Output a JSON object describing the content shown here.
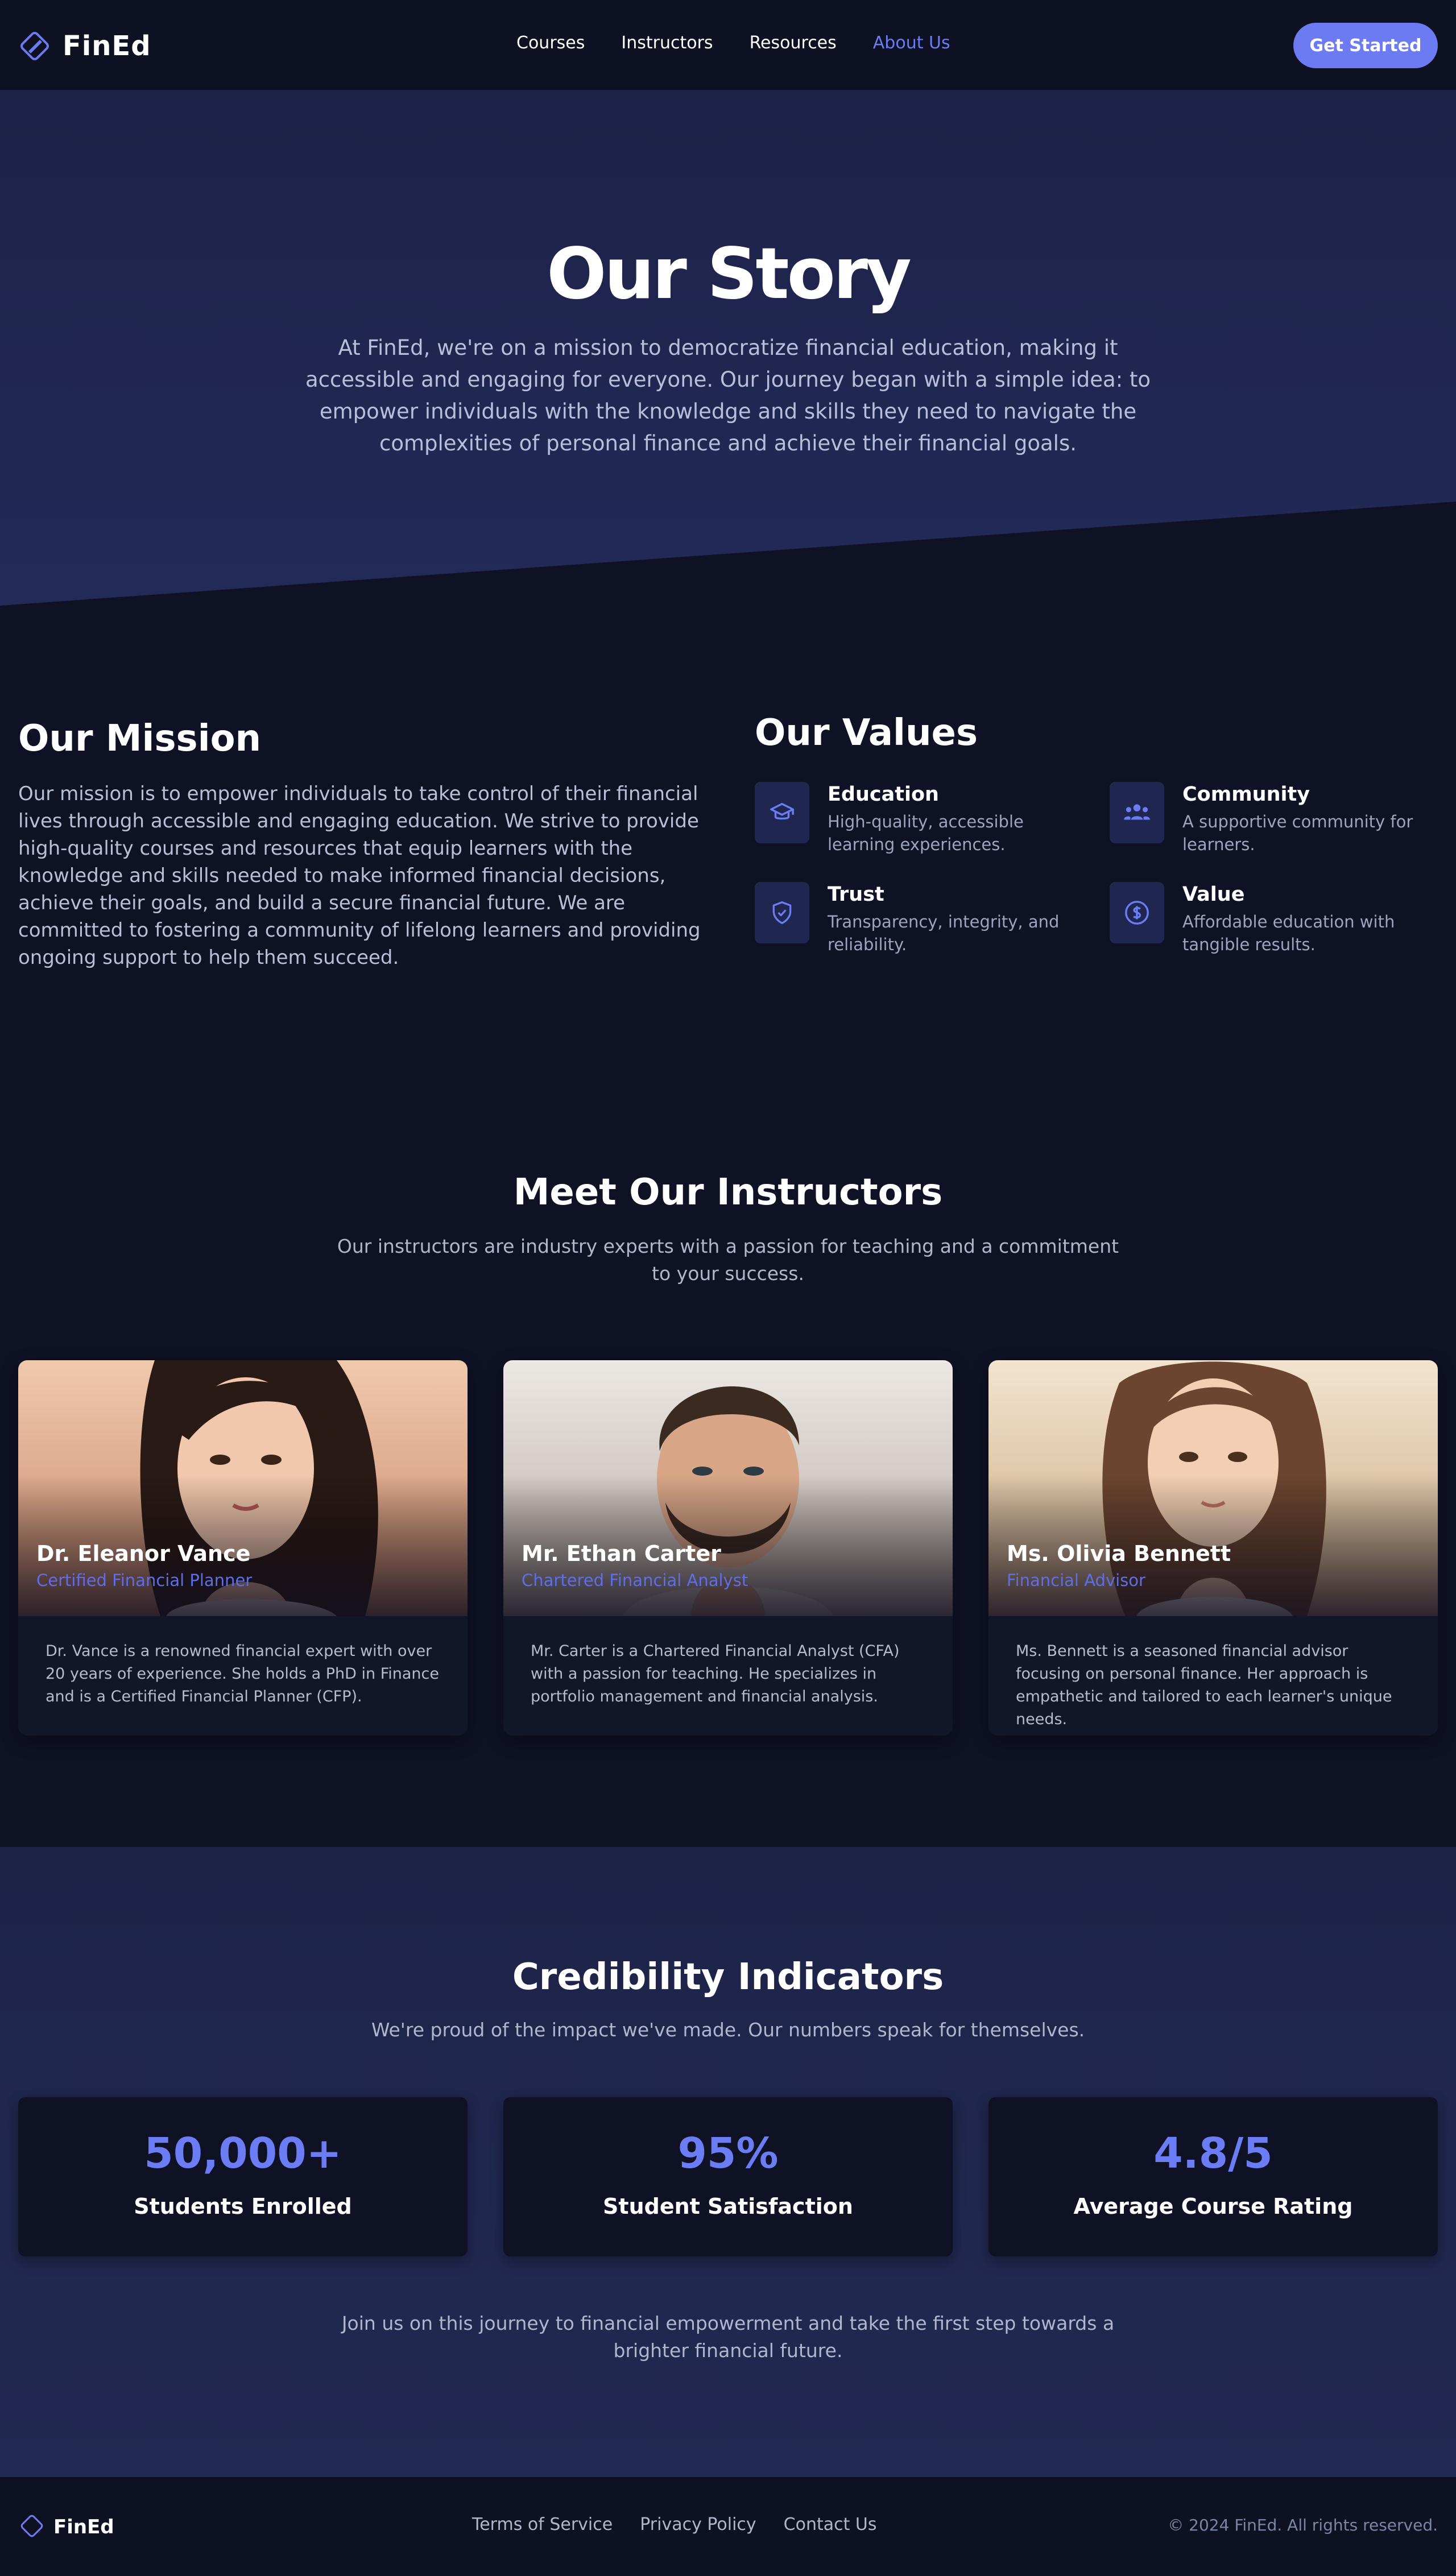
{
  "colors": {
    "accent": "#6c7bf2",
    "background": "#0f1225",
    "hero": "#1f2550",
    "muted_text": "#b9bfd6"
  },
  "nav": {
    "brand": "FinEd",
    "links": [
      "Courses",
      "Instructors",
      "Resources",
      "About Us"
    ],
    "active": "About Us",
    "cta": "Get Started"
  },
  "hero": {
    "title": "Our Story",
    "text": "At FinEd, we're on a mission to democratize financial education, making it accessible and engaging for everyone. Our journey began with a simple idea: to empower individuals with the knowledge and skills they need to navigate the complexities of personal finance and achieve their financial goals."
  },
  "mission": {
    "title": "Our Mission",
    "text": "Our mission is to empower individuals to take control of their financial lives through accessible and engaging education. We strive to provide high-quality courses and resources that equip learners with the knowledge and skills needed to make informed financial decisions, achieve their goals, and build a secure financial future. We are committed to fostering a community of lifelong learners and providing ongoing support to help them succeed."
  },
  "values": {
    "title": "Our Values",
    "items": [
      {
        "icon": "graduation-cap-icon",
        "name": "Education",
        "desc": "High-quality, accessible learning experiences."
      },
      {
        "icon": "people-icon",
        "name": "Community",
        "desc": "A supportive community for learners."
      },
      {
        "icon": "shield-check-icon",
        "name": "Trust",
        "desc": "Transparency, integrity, and reliability."
      },
      {
        "icon": "dollar-circle-icon",
        "name": "Value",
        "desc": "Affordable education with tangible results."
      }
    ]
  },
  "instructors": {
    "title": "Meet Our Instructors",
    "subtitle": "Our instructors are industry experts with a passion for teaching and a commitment to your success.",
    "cards": [
      {
        "name": "Dr. Eleanor Vance",
        "role": "Certified Financial Planner",
        "bio": "Dr. Vance is a renowned financial expert with over 20 years of experience. She holds a PhD in Finance and is a Certified Financial Planner (CFP)."
      },
      {
        "name": "Mr. Ethan Carter",
        "role": "Chartered Financial Analyst",
        "bio": "Mr. Carter is a Chartered Financial Analyst (CFA) with a passion for teaching. He specializes in portfolio management and financial analysis."
      },
      {
        "name": "Ms. Olivia Bennett",
        "role": "Financial Advisor",
        "bio": "Ms. Bennett is a seasoned financial advisor focusing on personal finance. Her approach is empathetic and tailored to each learner's unique needs."
      }
    ]
  },
  "credibility": {
    "title": "Credibility Indicators",
    "subtitle": "We're proud of the impact we've made. Our numbers speak for themselves.",
    "stats": [
      {
        "value": "50,000+",
        "label": "Students Enrolled"
      },
      {
        "value": "95%",
        "label": "Student Satisfaction"
      },
      {
        "value": "4.8/5",
        "label": "Average Course Rating"
      }
    ],
    "closing": "Join us on this journey to financial empowerment and take the first step towards a brighter financial future."
  },
  "footer": {
    "brand": "FinEd",
    "links": [
      "Terms of Service",
      "Privacy Policy",
      "Contact Us"
    ],
    "copyright": "© 2024 FinEd. All rights reserved."
  }
}
